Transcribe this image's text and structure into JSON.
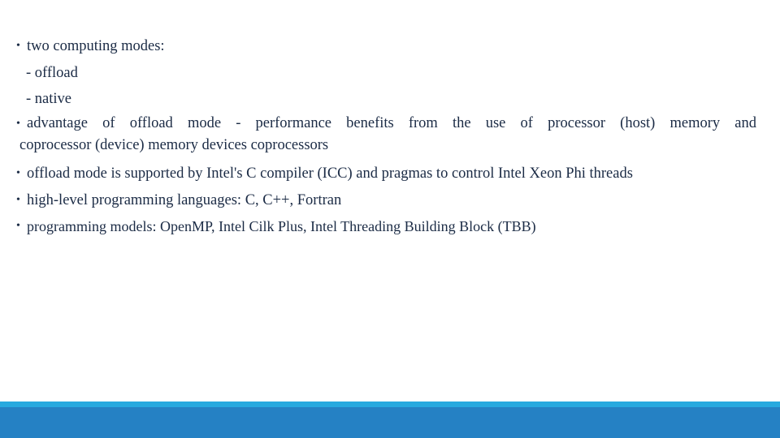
{
  "slide": {
    "bullet_glyph": "•",
    "text_color": "#1b2b45",
    "background_color": "#ffffff",
    "lines": [
      {
        "id": "l1",
        "level": 1,
        "text": "two computing modes:"
      },
      {
        "id": "l2",
        "level": 2,
        "text": "- offload"
      },
      {
        "id": "l3",
        "level": 2,
        "text": "- native"
      },
      {
        "id": "l4",
        "level": 1,
        "text_part_1": "advantage of offload mode - performance benefits from the use of processor (host) memory and",
        "text_part_2": "coprocessor (device) memory devices coprocessors"
      },
      {
        "id": "l5",
        "level": 1,
        "text": "offload mode is supported by Intel's C compiler (ICC) and pragmas to control Intel Xeon Phi threads"
      },
      {
        "id": "l6",
        "level": 1,
        "text": "high-level programming languages: C, C++, Fortran"
      },
      {
        "id": "l7",
        "level": 1,
        "text": "programming models: OpenMP, Intel Cilk Plus, Intel Threading Building Block (TBB)"
      }
    ]
  },
  "footer": {
    "light_band_color": "#27a9df",
    "dark_band_color": "#2581c4"
  }
}
